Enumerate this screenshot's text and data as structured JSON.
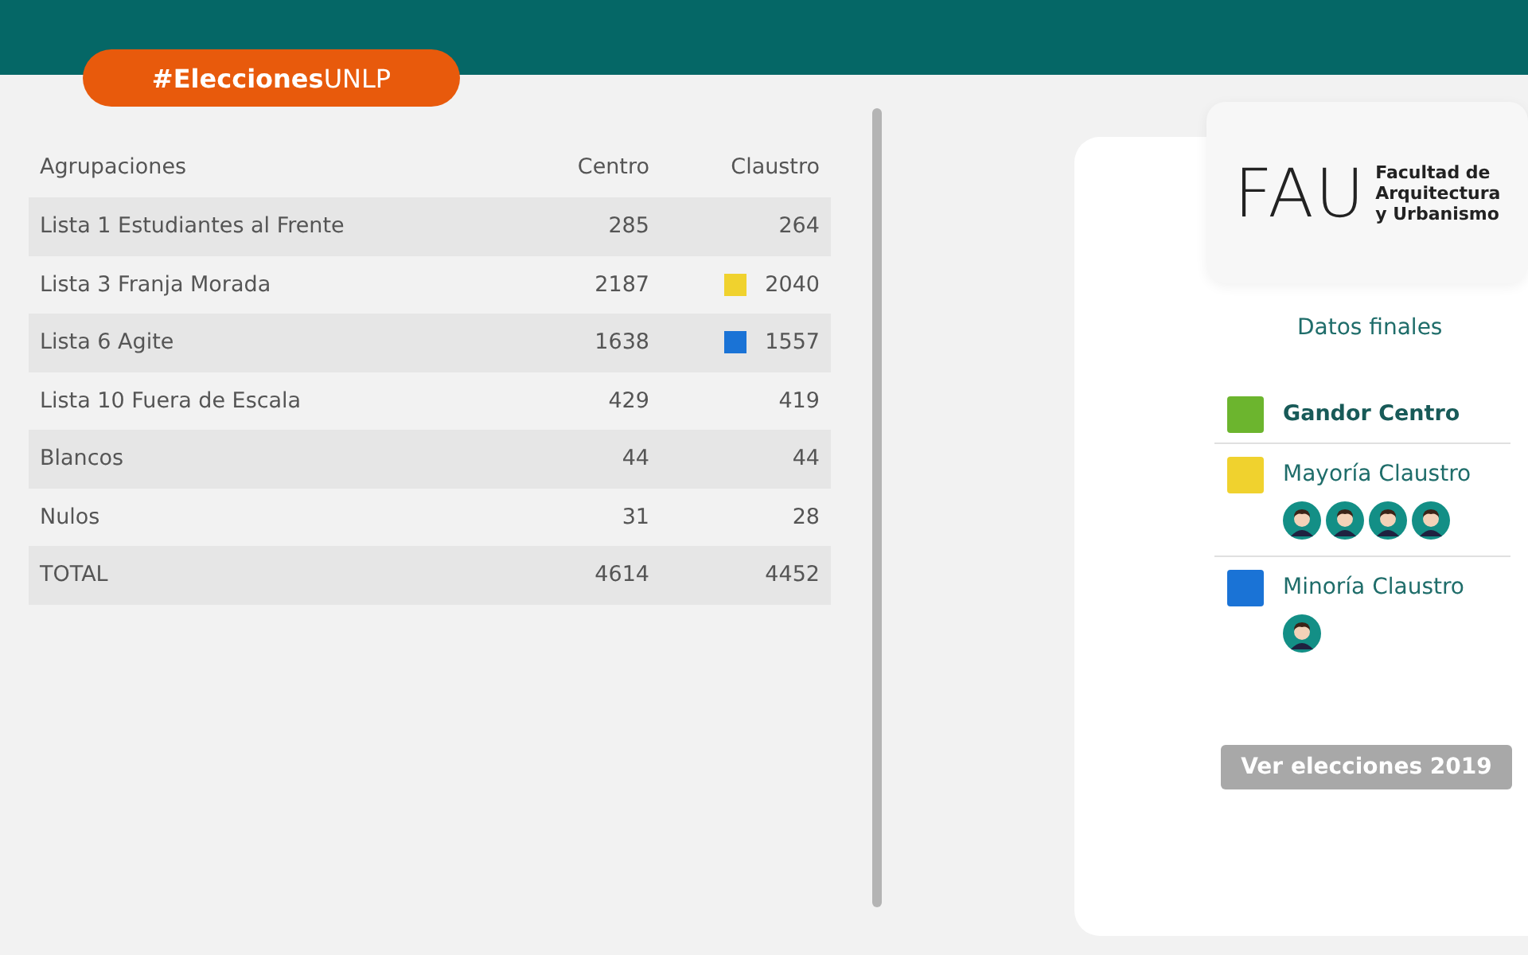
{
  "header": {
    "hashtag": "**#Elecciones**UNLP"
  },
  "table": {
    "columns": [
      "Agrupaciones",
      "Centro",
      "Claustro"
    ],
    "rows": [
      {
        "name": "Lista 1 Estudiantes al Frente",
        "centro": "285",
        "claustro": "264"
      },
      {
        "name": "Lista 3 Franja Morada",
        "centro": "2187",
        "claustro": "2040",
        "color": "#f0d22e"
      },
      {
        "name": "Lista 6 Agite",
        "centro": "1638",
        "claustro": "1557",
        "color": "#1a73d6"
      },
      {
        "name": "Lista 10 Fuera de Escala",
        "centro": "429",
        "claustro": "419"
      },
      {
        "name": "Blancos",
        "centro": "44",
        "claustro": "44"
      },
      {
        "name": "Nulos",
        "centro": "31",
        "claustro": "28"
      },
      {
        "name": "TOTAL",
        "centro": "4614",
        "claustro": "4452"
      }
    ]
  },
  "logo": {
    "mark": "FAU",
    "lines": [
      "Facultad de",
      "Arquitectura",
      "y Urbanismo"
    ]
  },
  "results": {
    "title": "Datos finales",
    "items": [
      {
        "label": "Gandor Centro",
        "color": "#6cb52e",
        "bold": true
      },
      {
        "label": "Mayoría Claustro",
        "color": "#f0d22e",
        "bold": false,
        "avatars": [
          {
            "kind": "person"
          },
          {
            "kind": "person"
          },
          {
            "kind": "person"
          },
          {
            "kind": "person"
          }
        ]
      },
      {
        "label": "Minoría Claustro",
        "color": "#1a73d6",
        "bold": false,
        "avatars": [
          {
            "kind": "person"
          }
        ]
      }
    ],
    "button": "Ver elecciones 2019"
  }
}
